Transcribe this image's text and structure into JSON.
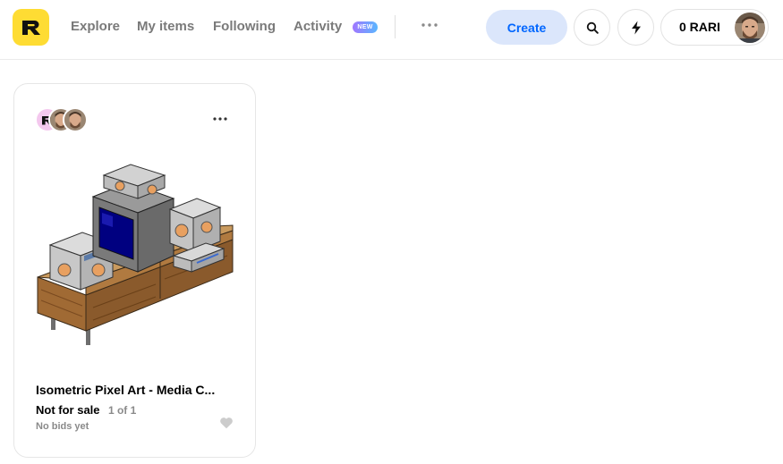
{
  "header": {
    "logo_letter": "R",
    "nav": {
      "explore": "Explore",
      "my_items": "My items",
      "following": "Following",
      "activity": "Activity",
      "activity_badge": "NEW"
    },
    "create_label": "Create",
    "balance_label": "0 RARI",
    "icons": {
      "logo": "rarible-logo-icon",
      "more": "more-horizontal-icon",
      "search": "search-icon",
      "lightning": "lightning-icon",
      "avatar": "user-avatar"
    }
  },
  "card": {
    "title": "Isometric Pixel Art - Media C...",
    "sale_status": "Not for sale",
    "edition": "1 of 1",
    "bids": "No bids yet",
    "artwork": "isometric pixel art media console with TV and stereo"
  },
  "colors": {
    "brand_yellow": "#fedc33",
    "create_bg": "#dbe6fb",
    "create_text": "#0066ff",
    "muted_text": "#7a7a7a",
    "badge_gradient_start": "#a176ff",
    "badge_gradient_end": "#5ab7ff",
    "heart": "#cccccc"
  }
}
